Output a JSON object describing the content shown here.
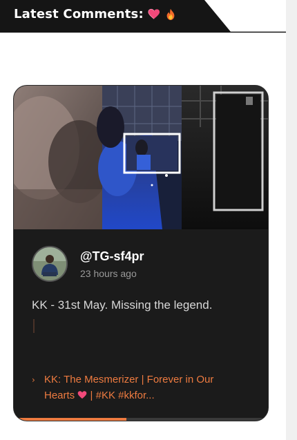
{
  "header": {
    "title": "Latest Comments:",
    "emojis": [
      "heart-emoji",
      "fire-emoji"
    ]
  },
  "card": {
    "author": "@TG-sf4pr",
    "time": "23 hours ago",
    "comment": "KK - 31st May. Missing the legend.",
    "video_title": "KK: The Mesmerizer | Forever in Our Hearts ❤️ | #KK #kkfor...",
    "video_title_part1": "KK: The Mesmerizer | Forever in Our",
    "video_title_part2a": "Hearts",
    "video_title_part2b": "| #KK #kkfor...",
    "progress_percent": 44,
    "colors": {
      "accent": "#ee7b40",
      "card_bg": "#1b1b1b",
      "header_bg": "#151515"
    }
  }
}
